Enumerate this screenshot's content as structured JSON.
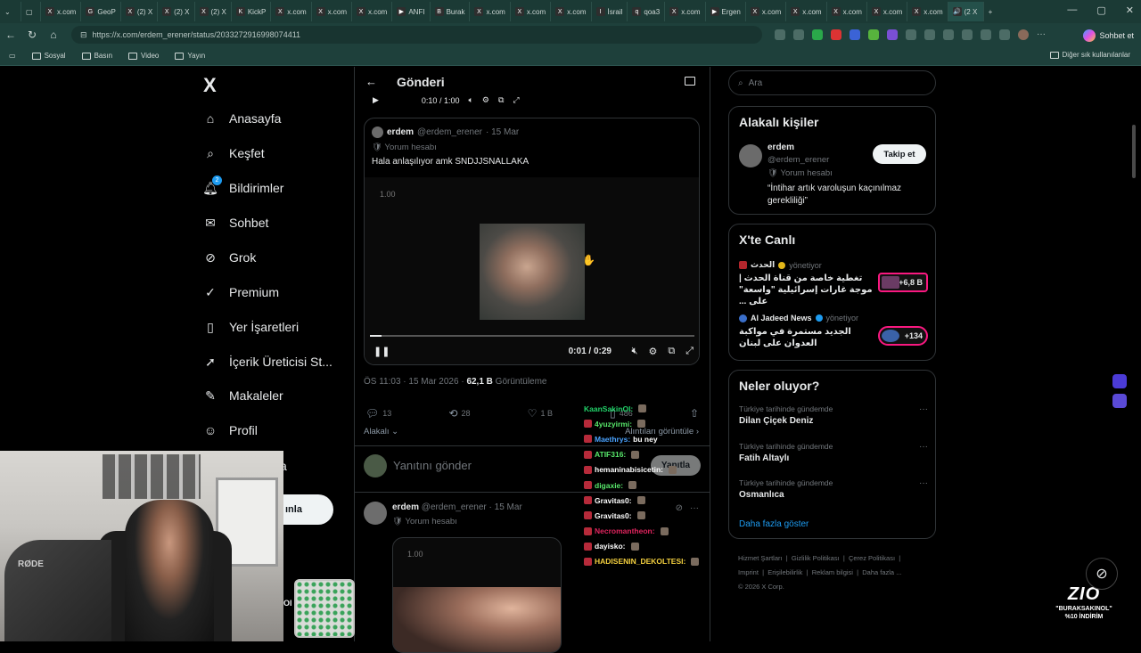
{
  "browser": {
    "tabs": [
      {
        "icon": "X",
        "label": "x.com"
      },
      {
        "icon": "G",
        "label": "GeoP"
      },
      {
        "icon": "X",
        "label": "(2) X"
      },
      {
        "icon": "X",
        "label": "(2) X"
      },
      {
        "icon": "X",
        "label": "(2) X"
      },
      {
        "icon": "K",
        "label": "KickP"
      },
      {
        "icon": "X",
        "label": "x.com"
      },
      {
        "icon": "X",
        "label": "x.com"
      },
      {
        "icon": "X",
        "label": "x.com"
      },
      {
        "icon": "▶",
        "label": "ANFI"
      },
      {
        "icon": "B",
        "label": "Burak"
      },
      {
        "icon": "X",
        "label": "x.com"
      },
      {
        "icon": "X",
        "label": "x.com"
      },
      {
        "icon": "X",
        "label": "x.com"
      },
      {
        "icon": "I",
        "label": "İsrail"
      },
      {
        "icon": "q",
        "label": "qoa3"
      },
      {
        "icon": "X",
        "label": "x.com"
      },
      {
        "icon": "▶",
        "label": "Ergen"
      },
      {
        "icon": "X",
        "label": "x.com"
      },
      {
        "icon": "X",
        "label": "x.com"
      },
      {
        "icon": "X",
        "label": "x.com"
      },
      {
        "icon": "X",
        "label": "x.com"
      },
      {
        "icon": "X",
        "label": "x.com"
      },
      {
        "icon": "🔊",
        "label": "(2 X"
      }
    ],
    "url": "https://x.com/erdem_erener/status/2033272916998074411",
    "chat_button": "Sohbet et",
    "bookmarks": [
      "Sosyal",
      "Basın",
      "Video",
      "Yayın"
    ],
    "bookmarks_other": "Diğer sık kullanılanlar"
  },
  "nav": {
    "logo": "X",
    "items": [
      {
        "label": "Anasayfa",
        "icon": "home-icon"
      },
      {
        "label": "Keşfet",
        "icon": "search-icon"
      },
      {
        "label": "Bildirimler",
        "icon": "bell-icon",
        "badge": "2"
      },
      {
        "label": "Sohbet",
        "icon": "mail-icon"
      },
      {
        "label": "Grok",
        "icon": "grok-icon"
      },
      {
        "label": "Premium",
        "icon": "verified-icon"
      },
      {
        "label": "Yer İşaretleri",
        "icon": "bookmark-icon"
      },
      {
        "label": "İçerik Üreticisi St...",
        "icon": "rocket-icon"
      },
      {
        "label": "Makaleler",
        "icon": "article-icon"
      },
      {
        "label": "Profil",
        "icon": "user-icon"
      }
    ],
    "partial_label": "a",
    "post_button": "ınla"
  },
  "main": {
    "header_title": "Gönderi",
    "top_video_time": "0:10 / 1:00",
    "quote": {
      "name": "erdem",
      "handle": "@erdem_erener",
      "date": "· 15 Mar",
      "sub": "Yorum hesabı",
      "text": "Hala anlaşılıyor amk SNDJJSNALLAKA",
      "video_label": "1.00",
      "progress": 0.035,
      "time": "0:01 / 0:29"
    },
    "meta_time": "ÖS 11:03 · 15 Mar 2026 · ",
    "meta_views": "62,1 B",
    "meta_views_label": " Görüntüleme",
    "actions": {
      "replies": "13",
      "reposts": "28",
      "likes": "1 B",
      "bookmarks": "486"
    },
    "sort_label": "Alakalı",
    "quotes_link": "Alıntıları görüntüle",
    "reply_placeholder": "Yanıtını gönder",
    "reply_button": "Yanıtla",
    "reply2": {
      "name": "erdem",
      "handle": "@erdem_erener",
      "date": "· 15 Mar",
      "sub": "Yorum hesabı",
      "video_label": "1.00"
    }
  },
  "chat": [
    {
      "user": "KaanSakinOl:",
      "color": "#22d36a",
      "msg": ""
    },
    {
      "user": "4yuzyirmi:",
      "color": "#58e86b",
      "msg": ""
    },
    {
      "user": "Maethrys:",
      "color": "#4aa3ff",
      "msg": "bu ney"
    },
    {
      "user": "ATIF316:",
      "color": "#58e86b",
      "msg": ""
    },
    {
      "user": "hemaninabisicetin:",
      "color": "#ffffff",
      "msg": ""
    },
    {
      "user": "digaxie:",
      "color": "#58e86b",
      "msg": ""
    },
    {
      "user": "Gravitas0:",
      "color": "#ffffff",
      "msg": ""
    },
    {
      "user": "Gravitas0:",
      "color": "#ffffff",
      "msg": ""
    },
    {
      "user": "Necromantheon:",
      "color": "#e0245e",
      "msg": ""
    },
    {
      "user": "dayisko:",
      "color": "#ffffff",
      "msg": ""
    },
    {
      "user": "HADISENIN_DEKOLTESI:",
      "color": "#f4d03f",
      "msg": ""
    }
  ],
  "right": {
    "search_placeholder": "Ara",
    "people_title": "Alakalı kişiler",
    "person": {
      "name": "erdem",
      "handle": "@erdem_erener",
      "sub": "Yorum hesabı",
      "bio": "“İntihar artık varoluşun kaçınılmaz gerekliliği”",
      "follow": "Takip et"
    },
    "live_title": "X'te Canlı",
    "live": [
      {
        "source": "الحدث",
        "status": "yönetiyor",
        "text": "تغطية خاصة من قناة الحدث | موجة غارات إسرائيلية \"واسعة\" على ...",
        "count": "+6,8 B"
      },
      {
        "source": "Al Jadeed News",
        "status": "yönetiyor",
        "text": "الجديد مستمرة في مواكبة العدوان على لبنان",
        "count": "+134"
      }
    ],
    "trends_title": "Neler oluyor?",
    "trends": [
      {
        "category": "Türkiye tarihinde gündemde",
        "name": "Dilan Çiçek Deniz"
      },
      {
        "category": "Türkiye tarihinde gündemde",
        "name": "Fatih Altaylı"
      },
      {
        "category": "Türkiye tarihinde gündemde",
        "name": "Osmanlıca"
      }
    ],
    "show_more": "Daha fazla göster",
    "footer": [
      "Hizmet Şartları",
      "Gizlilik Politikası",
      "Çerez Politikası",
      "Imprint",
      "Erişilebilirlik",
      "Reklam bilgisi",
      "Daha fazla ...",
      "© 2026 X Corp."
    ]
  },
  "overlay": {
    "webcam_brand": "RØDE",
    "partial_text": "OI",
    "promo_logo": "ZIO",
    "promo_line1": "\"BURAKSAKINOL\"",
    "promo_line2": "%10 İNDİRİM"
  }
}
